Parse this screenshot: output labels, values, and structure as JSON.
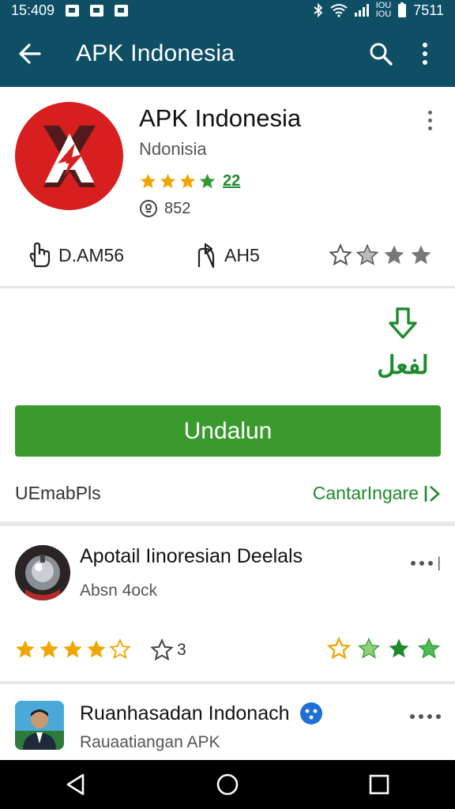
{
  "status_bar": {
    "time_left": "15:409",
    "sig_label_top": "IOU",
    "sig_label_bottom": "IOU",
    "time_right": "7511"
  },
  "app_bar": {
    "title": "APK Indonesia",
    "back_icon": "arrow-left-icon",
    "search_icon": "search-icon",
    "overflow_icon": "more-vert-icon"
  },
  "app": {
    "name": "APK Indonesia",
    "developer": "Ndonisia",
    "rating_stars": 4,
    "rating_count": "22",
    "downloads": "852",
    "meta_left": "D.AM56",
    "meta_mid": "AH5",
    "meta_stars_filled": 2
  },
  "install": {
    "badge_text": "لفعل",
    "button_label": "Undalun",
    "similar_label": "UEmabPls",
    "similar_link": "CantarIngare"
  },
  "list": [
    {
      "title": "Apotail Iinoresian Deelals",
      "subtitle": "Absn 4ock",
      "rating_stars": 4,
      "mid_value": "3",
      "right_stars": 3
    },
    {
      "title": "Ruanhasadan Indonach",
      "subtitle": "Rauaatiangan APK",
      "verified": true
    }
  ],
  "colors": {
    "app_bar": "#0e4f66",
    "accent_green": "#3a9a2e",
    "logo_red": "#d71f1f",
    "star_gold": "#f0a500",
    "star_green": "#2e9a2e"
  }
}
